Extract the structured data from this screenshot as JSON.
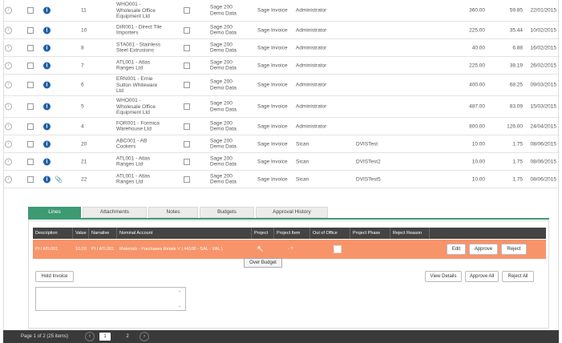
{
  "invoices": [
    {
      "id": "11",
      "supplier": "WHO001 - Wholesale Office Equipment Ltd",
      "source": "Sage 200 Demo Data",
      "type": "Sage Invoice",
      "user": "Administrator",
      "workflow": "",
      "net": "360.00",
      "tax": "59.85",
      "date": "22/01/2015",
      "tall": true,
      "attach": false
    },
    {
      "id": "10",
      "supplier": "DIR001 - Direct Tile Importers",
      "source": "Sage 200 Demo Data",
      "type": "Sage Invoice",
      "user": "Administrator",
      "workflow": "",
      "net": "225.00",
      "tax": "35.44",
      "date": "10/02/2015",
      "tall": false,
      "attach": false
    },
    {
      "id": "8",
      "supplier": "STA001 - Stainless Steel Extrusions",
      "source": "Sage 200 Demo Data",
      "type": "Sage Invoice",
      "user": "Administrator",
      "workflow": "",
      "net": "40.00",
      "tax": "6.88",
      "date": "16/02/2015",
      "tall": false,
      "attach": false
    },
    {
      "id": "7",
      "supplier": "ATL001 - Atlas Ranges Ltd",
      "source": "Sage 200 Demo Data",
      "type": "Sage Invoice",
      "user": "Administrator",
      "workflow": "",
      "net": "225.00",
      "tax": "38.19",
      "date": "26/02/2015",
      "tall": false,
      "attach": false
    },
    {
      "id": "6",
      "supplier": "ERN001 - Ernie Sutton Whiteware Ltd",
      "source": "Sage 200 Demo Data",
      "type": "Sage Invoice",
      "user": "Administrator",
      "workflow": "",
      "net": "400.00",
      "tax": "68.25",
      "date": "09/03/2015",
      "tall": true,
      "attach": false
    },
    {
      "id": "5",
      "supplier": "WHO001 - Wholesale Office Equipment Ltd",
      "source": "Sage 200 Demo Data",
      "type": "Sage Invoice",
      "user": "Administrator",
      "workflow": "",
      "net": "487.00",
      "tax": "83.09",
      "date": "15/03/2015",
      "tall": true,
      "attach": false
    },
    {
      "id": "4",
      "supplier": "FOR001 - Formica Warehouse Ltd",
      "source": "Sage 200 Demo Data",
      "type": "Sage Invoice",
      "user": "Administrator",
      "workflow": "",
      "net": "800.00",
      "tax": "126.00",
      "date": "24/04/2015",
      "tall": false,
      "attach": false
    },
    {
      "id": "20",
      "supplier": "ABC001 - AB Cookers",
      "source": "Sage 200 Demo Data",
      "type": "Sage Invoice",
      "user": "Sican",
      "workflow": "DVISTest",
      "net": "10.00",
      "tax": "1.75",
      "date": "08/06/2015",
      "tall": false,
      "attach": false
    },
    {
      "id": "21",
      "supplier": "ATL001 - Atlas Ranges Ltd",
      "source": "Sage 200 Demo Data",
      "type": "Sage Invoice",
      "user": "Sican",
      "workflow": "DVISTest2",
      "net": "10.00",
      "tax": "1.75",
      "date": "08/06/2015",
      "tall": false,
      "attach": false
    },
    {
      "id": "22",
      "supplier": "ATL001 - Atlas Ranges Ltd",
      "source": "Sage 200 Demo Data",
      "type": "Sage Invoice",
      "user": "Sican",
      "workflow": "DVISTest5",
      "net": "10.00",
      "tax": "1.75",
      "date": "08/06/2015",
      "tall": false,
      "attach": true
    }
  ],
  "tabs": [
    "Lines",
    "Attachments",
    "Notes",
    "Budgets",
    "Approval History"
  ],
  "lines": {
    "headers": [
      "Description",
      "Value",
      "Narrative",
      "Nominal Account",
      "Project",
      "Project Item",
      "Out of Office",
      "Project Phase",
      "Reject Reason"
    ],
    "row": {
      "description": "PI / ATL001",
      "value": "10.00",
      "narrative": "PI / ATL001",
      "nominal": "Materials - Purchases Retale V | 44100 - SAL - VAL )",
      "project_item": "- ?"
    },
    "row_buttons": [
      "Edit",
      "Approve",
      "Reject"
    ],
    "tooltip": "Over Budget",
    "hold_label": "Hold Invoice",
    "bottom_buttons": [
      "View Details",
      "Approve All",
      "Reject All"
    ]
  },
  "footer": {
    "page_info": "Page 1 of 2 (25 items)",
    "pages": [
      "1",
      "2"
    ]
  },
  "colors": {
    "accent": "#3d9a73",
    "line_row": "#f8946a",
    "header_dark": "#444444",
    "info_blue": "#1f5fa8"
  }
}
